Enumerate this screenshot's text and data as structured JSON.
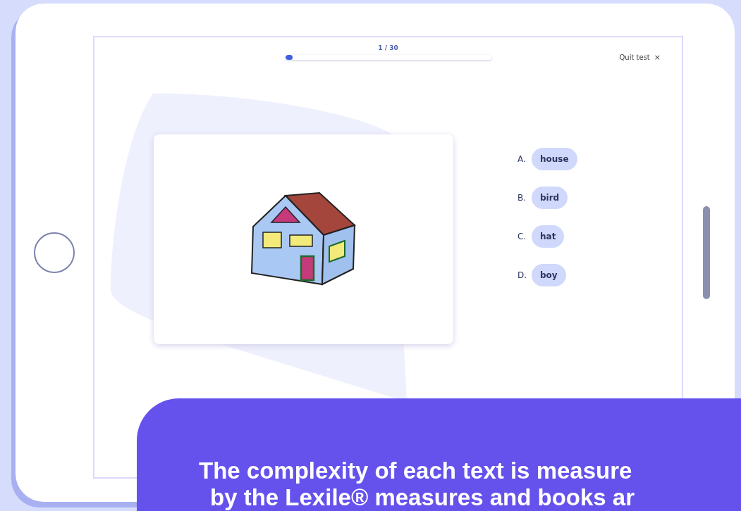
{
  "progress": {
    "label": "1 / 30",
    "level": 0.035
  },
  "quit": {
    "label": "Quit test",
    "close": "×"
  },
  "options": [
    {
      "letter": "A.",
      "text": "house",
      "selected": false
    },
    {
      "letter": "B.",
      "text": "bird",
      "selected": false
    },
    {
      "letter": "C.",
      "text": "hat",
      "selected": false
    },
    {
      "letter": "D.",
      "text": "boy",
      "selected": false
    }
  ],
  "caption": {
    "lines": [
      "The complexity of each text is measure",
      "by the Lexile® measures and books ar"
    ]
  }
}
